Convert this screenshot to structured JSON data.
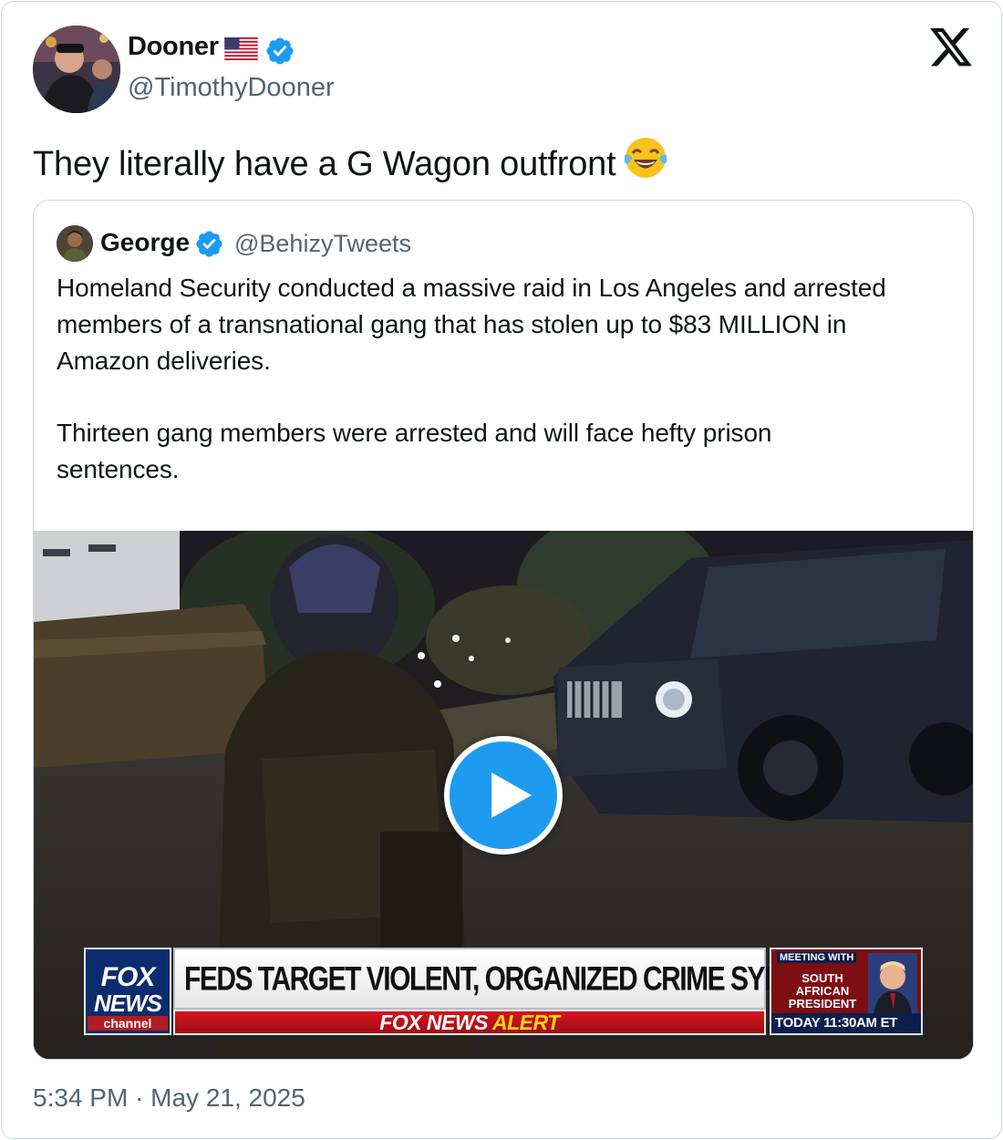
{
  "author": {
    "name": "Dooner",
    "handle": "@TimothyDooner",
    "flag_icon": "us-flag-icon",
    "verified_icon": "verified-badge-icon"
  },
  "tweet": {
    "text": "They literally have a G Wagon outfront",
    "emoji_icon": "tears-of-joy-emoji-icon",
    "timestamp": "5:34 PM · May 21, 2025"
  },
  "quoted": {
    "name": "George",
    "handle": "@BehizyTweets",
    "paragraph_1_line_1": "Homeland Security conducted a massive raid in Los Angeles and arrested",
    "paragraph_1_line_2": "members of a transnational gang that has stolen up to $83 MILLION in",
    "paragraph_1_line_3": "Amazon deliveries.",
    "paragraph_2_line_1": "Thirteen gang members were arrested and will face hefty prison",
    "paragraph_2_line_2": "sentences."
  },
  "video": {
    "play_icon": "play-icon",
    "chyron": {
      "logo_line_1": "FOX",
      "logo_line_2": "NEWS",
      "logo_line_3": "channel",
      "headline": "FEDS TARGET VIOLENT, ORGANIZED CRIME SYNDICATE",
      "alert_prefix": "FOX NEWS",
      "alert_suffix": "ALERT",
      "side_top": "MEETING WITH",
      "side_mid": "SOUTH AFRICAN PRESIDENT",
      "side_bottom": "TODAY 11:30AM ET"
    }
  },
  "colors": {
    "accent": "#1d9bf0",
    "text_primary": "#0f1419",
    "text_secondary": "#536471",
    "border": "#cfd9de"
  },
  "brand_icon": "x-logo-icon"
}
